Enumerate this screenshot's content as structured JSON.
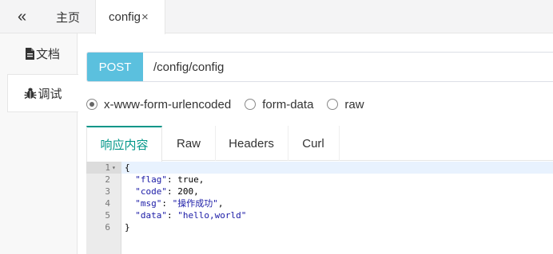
{
  "topbar": {
    "collapse_icon": "double-chevron-left-icon",
    "collapse_glyph": "«",
    "tabs": [
      {
        "label": "主页"
      },
      {
        "label": "config",
        "close": "×"
      }
    ]
  },
  "sidebar": {
    "tabs": [
      {
        "label": "文档",
        "icon": "document-icon"
      },
      {
        "label": "调试",
        "icon": "bug-icon"
      }
    ]
  },
  "request": {
    "method": "POST",
    "url": "/config/config",
    "method_color": "#5bc0de"
  },
  "body_types": [
    {
      "label": "x-www-form-urlencoded",
      "checked": true
    },
    {
      "label": "form-data",
      "checked": false
    },
    {
      "label": "raw",
      "checked": false
    }
  ],
  "response_tabs": [
    {
      "label": "响应内容",
      "active": true
    },
    {
      "label": "Raw",
      "active": false
    },
    {
      "label": "Headers",
      "active": false
    },
    {
      "label": "Curl",
      "active": false
    }
  ],
  "accent_color": "#009688",
  "editor": {
    "lines": [
      {
        "n": "1",
        "text": "{",
        "fold": "▾"
      },
      {
        "n": "2",
        "text": "  \"flag\": true,"
      },
      {
        "n": "3",
        "text": "  \"code\": 200,"
      },
      {
        "n": "4",
        "text": "  \"msg\": \"操作成功\","
      },
      {
        "n": "5",
        "text": "  \"data\": \"hello,world\""
      },
      {
        "n": "6",
        "text": "}"
      }
    ]
  }
}
